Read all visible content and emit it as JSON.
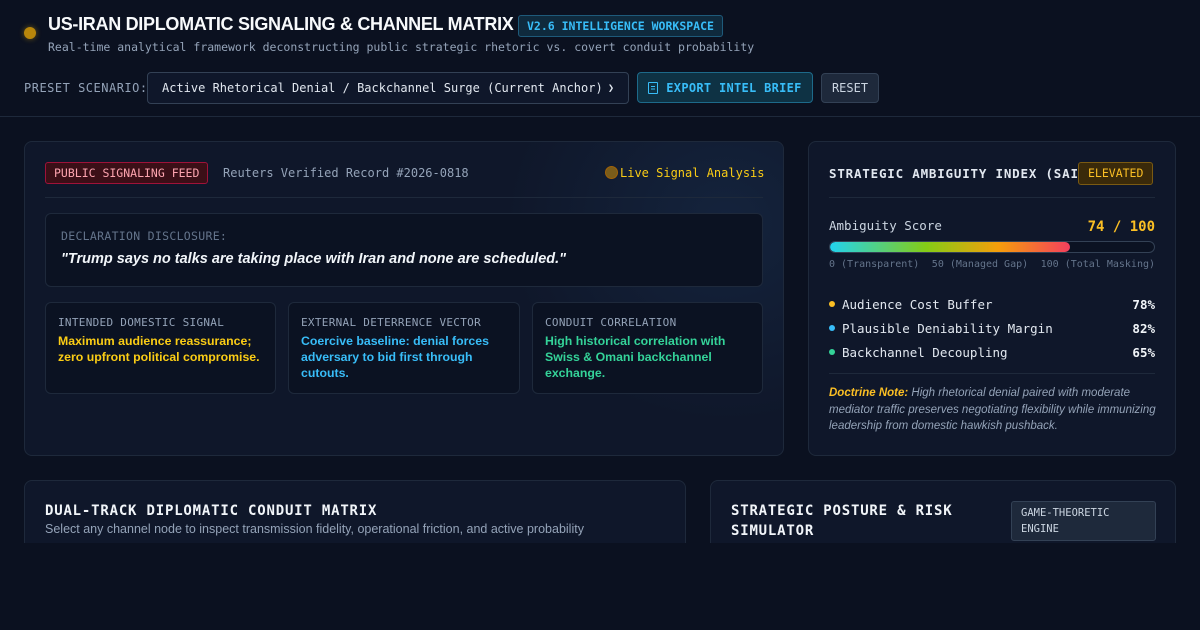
{
  "header": {
    "title": "US-IRAN DIPLOMATIC SIGNALING & CHANNEL MATRIX",
    "version_badge": "V2.6 INTELLIGENCE WORKSPACE",
    "subtitle": "Real-time analytical framework deconstructing public strategic rhetoric vs. covert conduit probability",
    "status_color": "#b8860b"
  },
  "controls": {
    "preset_label": "PRESET SCENARIO:",
    "preset_selected": "Active Rhetorical Denial / Backchannel Surge (Current Anchor)",
    "export_label": "EXPORT INTEL BRIEF",
    "export_icon": "document-icon",
    "reset_label": "RESET"
  },
  "signal_panel": {
    "feed_badge": "PUBLIC SIGNALING FEED",
    "record_id": "Reuters Verified Record #2026-0818",
    "live_label": "Live Signal Analysis",
    "declaration_label": "DECLARATION DISCLOSURE:",
    "declaration_quote": "\"Trump says no talks are taking place with Iran and none are scheduled.\"",
    "insights": [
      {
        "label": "INTENDED DOMESTIC SIGNAL",
        "text": "Maximum audience reassurance; zero upfront political compromise.",
        "color": "#facc15"
      },
      {
        "label": "EXTERNAL DETERRENCE VECTOR",
        "text": "Coercive baseline: denial forces adversary to bid first through cutouts.",
        "color": "#38bdf8"
      },
      {
        "label": "CONDUIT CORRELATION",
        "text": "High historical correlation with Swiss & Omani backchannel exchange.",
        "color": "#34d399"
      }
    ]
  },
  "sai": {
    "title": "STRATEGIC AMBIGUITY INDEX (SAI)",
    "level_badge": "ELEVATED",
    "score_label": "Ambiguity Score",
    "score_text": "74 / 100",
    "score_value": 74,
    "scale": [
      "0 (Transparent)",
      "50 (Managed Gap)",
      "100 (Total Masking)"
    ],
    "metrics": [
      {
        "label": "Audience Cost Buffer",
        "value": "78%",
        "color": "#fbbf24"
      },
      {
        "label": "Plausible Deniability Margin",
        "value": "82%",
        "color": "#38bdf8"
      },
      {
        "label": "Backchannel Decoupling",
        "value": "65%",
        "color": "#34d399"
      }
    ],
    "doctrine_label": "Doctrine Note:",
    "doctrine_text": " High rhetorical denial paired with moderate mediator traffic preserves negotiating flexibility while immunizing leadership from domestic hawkish pushback."
  },
  "matrix": {
    "title": "DUAL-TRACK DIPLOMATIC CONDUIT MATRIX",
    "subtitle": "Select any channel node to inspect transmission fidelity, operational friction, and active probability"
  },
  "posture": {
    "title": "STRATEGIC POSTURE & RISK SIMULATOR",
    "engine_badge": "GAME-THEORETIC ENGINE"
  }
}
